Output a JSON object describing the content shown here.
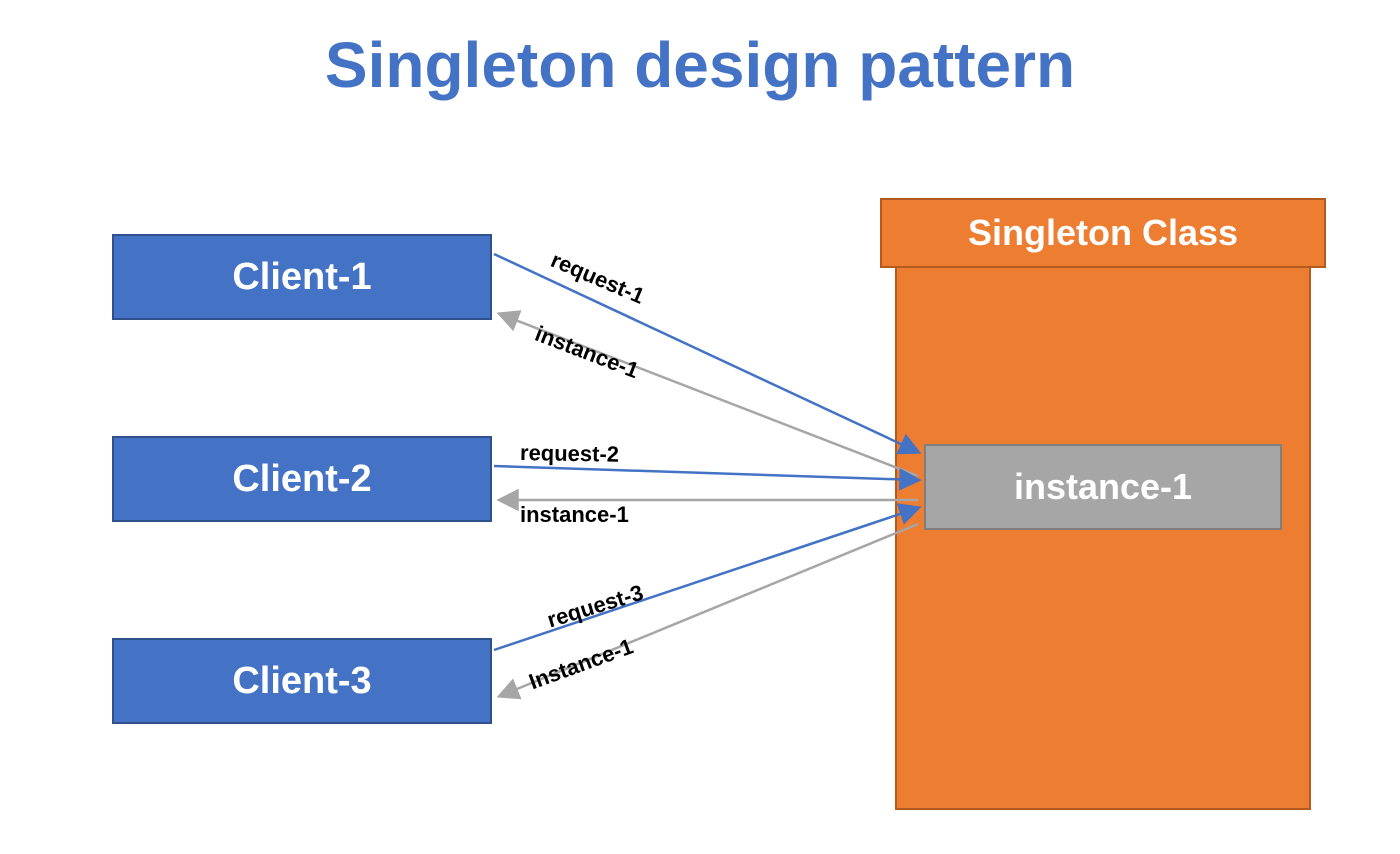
{
  "title": "Singleton design pattern",
  "clients": [
    {
      "label": "Client-1"
    },
    {
      "label": "Client-2"
    },
    {
      "label": "Client-3"
    }
  ],
  "singleton": {
    "header_label": "Singleton Class",
    "instance_label": "instance-1"
  },
  "arrows": {
    "c1_req": "request-1",
    "c1_res": "instance-1",
    "c2_req": "request-2",
    "c2_res": "instance-1",
    "c3_req": "request-3",
    "c3_res": "Instance-1"
  },
  "colors": {
    "title": "#4472C4",
    "client_fill": "#4472C4",
    "client_border": "#2F528F",
    "singleton_fill": "#ED7D31",
    "singleton_border": "#B35A1F",
    "instance_fill": "#A6A6A6",
    "instance_border": "#7F7F7F",
    "request_arrow": "#4472C4",
    "response_arrow": "#A6A6A6"
  }
}
